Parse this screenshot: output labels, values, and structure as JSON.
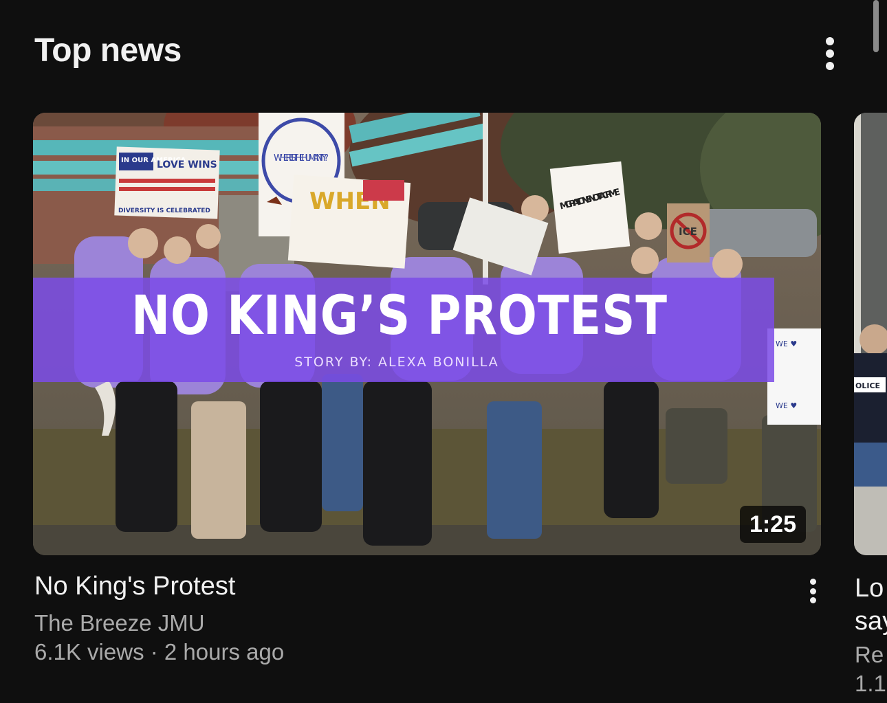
{
  "section": {
    "title": "Top news",
    "menu_icon": "more-vert-icon"
  },
  "video": {
    "thumbnail_banner_title": "NO KING’S PROTEST",
    "thumbnail_banner_subtitle": "STORY BY: ALEXA BONILLA",
    "duration": "1:25",
    "title": "No King's Protest",
    "channel": "The Breeze JMU",
    "meta": "6.1K views · 2 hours ago",
    "menu_icon": "more-vert-icon"
  },
  "next_video": {
    "title_line1": "Lo",
    "title_line2": "say",
    "channel": "Re",
    "meta": "1.1"
  },
  "signs": {
    "in_our_america": "IN OUR AMERICA",
    "love_wins": "LOVE WINS",
    "diversity": "DIVERSITY IS CELEBRATED",
    "where_humanity": "WHERE IS THE HUMANITY?",
    "when_normal": "WHEN",
    "migration": "MIGRATION IS NOT A CRIME",
    "ice": "ICE",
    "police": "OLICE",
    "we_love": "WE ♥"
  },
  "colors": {
    "background": "#0f0f0f",
    "banner": "#7c4ce6",
    "text_primary": "#f1f1f1",
    "text_secondary": "#aaaaaa"
  }
}
